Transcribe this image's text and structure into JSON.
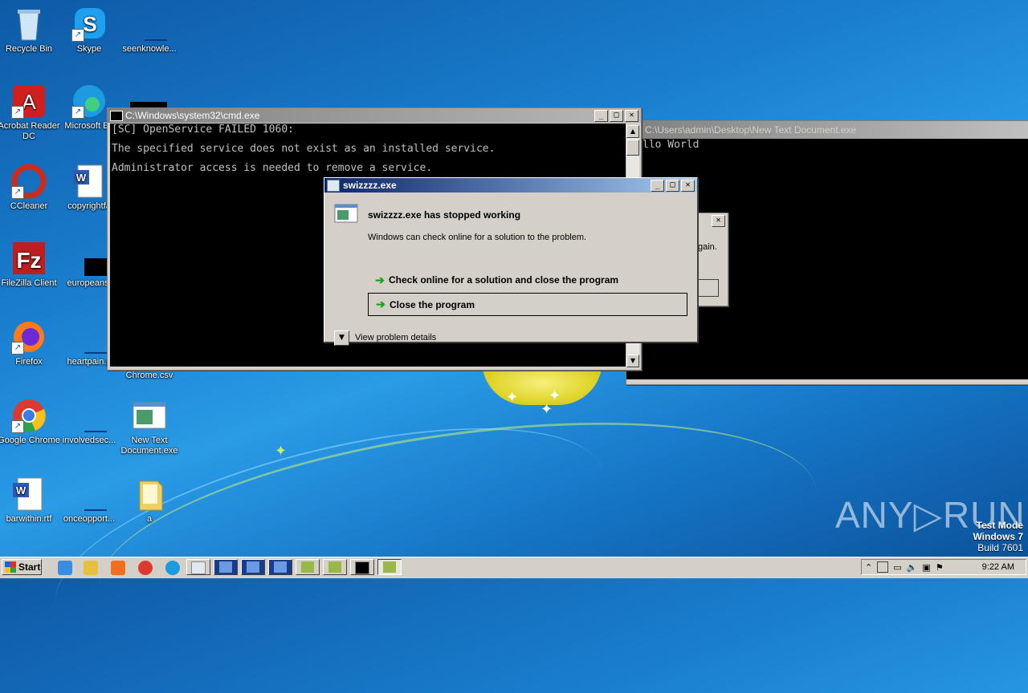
{
  "desktop": {
    "icons": [
      {
        "label": "Recycle Bin",
        "icon": "recycle-bin-icon"
      },
      {
        "label": "Skype",
        "icon": "skype-icon"
      },
      {
        "label": "seenknowle...",
        "icon": "document-icon"
      },
      {
        "label": "Acrobat Reader DC",
        "icon": "acrobat-icon"
      },
      {
        "label": "Microsoft Ed",
        "icon": "edge-icon"
      },
      {
        "label": "CCleaner",
        "icon": "ccleaner-icon"
      },
      {
        "label": "copyrightfa",
        "icon": "word-doc-icon"
      },
      {
        "label": "FileZilla Client",
        "icon": "filezilla-icon"
      },
      {
        "label": "europeanst",
        "icon": "document-icon"
      },
      {
        "label": "Firefox",
        "icon": "firefox-icon"
      },
      {
        "label": "heartpain.p",
        "icon": "document-icon"
      },
      {
        "label": "Chrome.csv",
        "icon": "csv-icon"
      },
      {
        "label": "Google Chrome",
        "icon": "chrome-icon"
      },
      {
        "label": "involvedsec...",
        "icon": "document-icon"
      },
      {
        "label": "New Text Document.exe",
        "icon": "exe-icon"
      },
      {
        "label": "barwithin.rtf",
        "icon": "word-doc-icon"
      },
      {
        "label": "onceopport...",
        "icon": "document-icon"
      },
      {
        "label": "a",
        "icon": "folder-icon"
      }
    ]
  },
  "cmd_window": {
    "title": "C:\\Windows\\system32\\cmd.exe",
    "lines": [
      "[SC] OpenService FAILED 1060:",
      "The specified service does not exist as an installed service.",
      "Administrator access is needed to remove a service."
    ]
  },
  "bg_window": {
    "title": "C:\\Users\\admin\\Desktop\\New Text Document.exe",
    "line": "llo World"
  },
  "hidden_dialog": {
    "partial_text": "gain."
  },
  "error_dialog": {
    "title": "swizzzz.exe",
    "heading": "swizzzz.exe has stopped working",
    "message": "Windows can check online for a solution to the problem.",
    "option_check_online": "Check online for a solution and close the program",
    "option_close": "Close the program",
    "details_label": "View problem details"
  },
  "taskbar": {
    "start_label": "Start",
    "clock": "9:22 AM"
  },
  "watermark": {
    "brand": "ANY▷RUN",
    "test_mode": "Test Mode",
    "os": "Windows 7",
    "build": "Build 7601"
  },
  "colors": {
    "titlebar_active": "#0a246a",
    "titlebar_inactive": "#808080",
    "desktop": "#1a7fd0",
    "arrow_green": "#1fa31f"
  }
}
